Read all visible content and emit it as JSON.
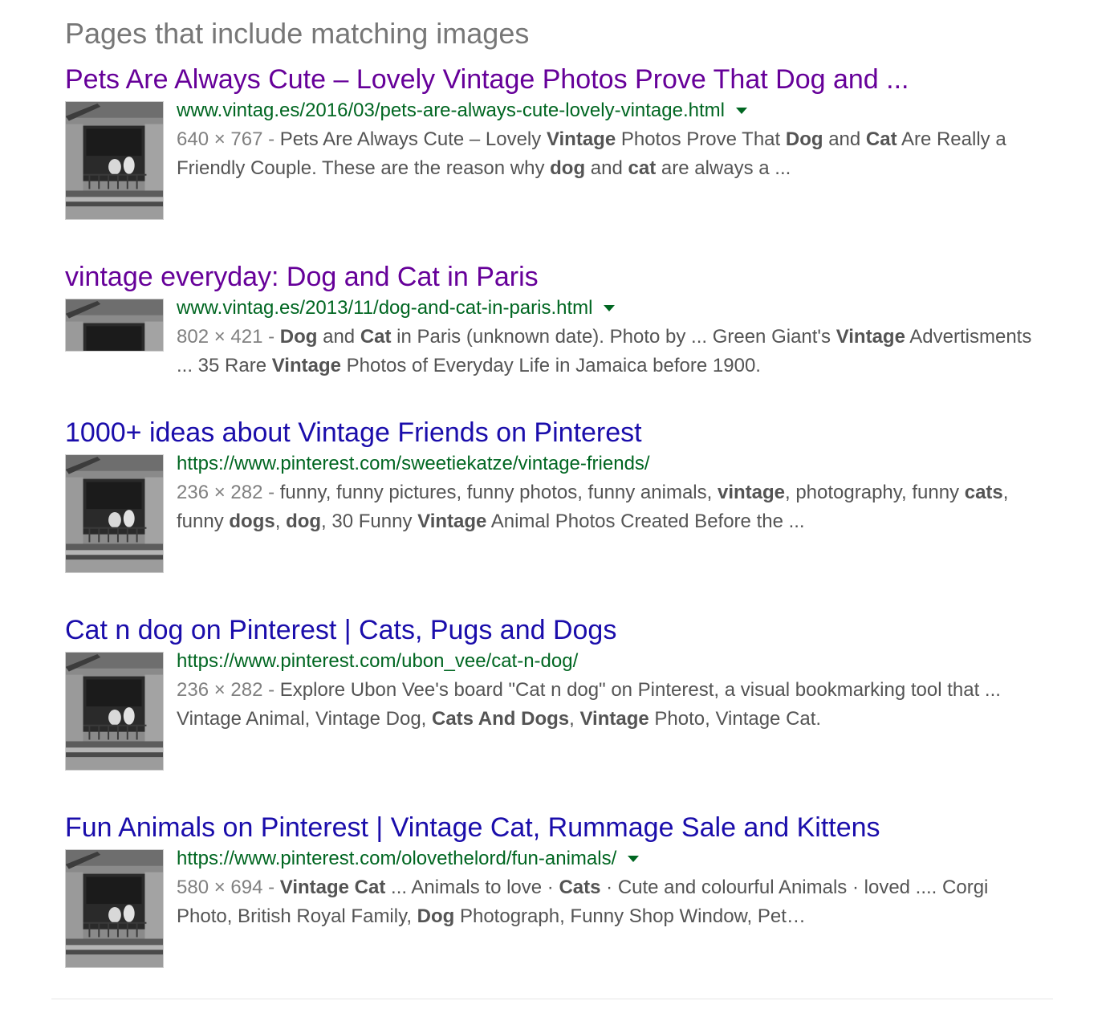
{
  "section_heading": "Pages that include matching images",
  "results": [
    {
      "title": "Pets Are Always Cute – Lovely Vintage Photos Prove That Dog and ...",
      "url": "www.vintag.es/2016/03/pets-are-always-cute-lovely-vintage.html",
      "has_caret": true,
      "visited": true,
      "thumbnail": "tall",
      "dims": "640 × 767",
      "snippet_segments": [
        {
          "text": "Pets Are Always Cute – Lovely ",
          "bold": false
        },
        {
          "text": "Vintage",
          "bold": true
        },
        {
          "text": " Photos Prove That ",
          "bold": false
        },
        {
          "text": "Dog",
          "bold": true
        },
        {
          "text": " and ",
          "bold": false
        },
        {
          "text": "Cat",
          "bold": true
        },
        {
          "text": " Are Really a Friendly Couple. These are the reason why ",
          "bold": false
        },
        {
          "text": "dog",
          "bold": true
        },
        {
          "text": " and ",
          "bold": false
        },
        {
          "text": "cat",
          "bold": true
        },
        {
          "text": " are always a ...",
          "bold": false
        }
      ]
    },
    {
      "title": "vintage everyday: Dog and Cat in Paris",
      "url": "www.vintag.es/2013/11/dog-and-cat-in-paris.html",
      "has_caret": true,
      "visited": true,
      "thumbnail": "short",
      "dims": "802 × 421",
      "snippet_segments": [
        {
          "text": "Dog",
          "bold": true
        },
        {
          "text": " and ",
          "bold": false
        },
        {
          "text": "Cat",
          "bold": true
        },
        {
          "text": " in Paris (unknown date). Photo by ... Green Giant's ",
          "bold": false
        },
        {
          "text": "Vintage",
          "bold": true
        },
        {
          "text": " Advertisments ... 35 Rare ",
          "bold": false
        },
        {
          "text": "Vintage",
          "bold": true
        },
        {
          "text": " Photos of Everyday Life in Jamaica before 1900.",
          "bold": false
        }
      ]
    },
    {
      "title": "1000+ ideas about Vintage Friends on Pinterest",
      "url": "https://www.pinterest.com/sweetiekatze/vintage-friends/",
      "has_caret": false,
      "visited": false,
      "thumbnail": "tall",
      "dims": "236 × 282",
      "snippet_segments": [
        {
          "text": "funny, funny pictures, funny photos, funny animals, ",
          "bold": false
        },
        {
          "text": "vintage",
          "bold": true
        },
        {
          "text": ", photography, funny ",
          "bold": false
        },
        {
          "text": "cats",
          "bold": true
        },
        {
          "text": ", funny ",
          "bold": false
        },
        {
          "text": "dogs",
          "bold": true
        },
        {
          "text": ", ",
          "bold": false
        },
        {
          "text": "dog",
          "bold": true
        },
        {
          "text": ", 30 Funny ",
          "bold": false
        },
        {
          "text": "Vintage",
          "bold": true
        },
        {
          "text": " Animal Photos Created Before the ...",
          "bold": false
        }
      ]
    },
    {
      "title": "Cat n dog on Pinterest | Cats, Pugs and Dogs",
      "url": "https://www.pinterest.com/ubon_vee/cat-n-dog/",
      "has_caret": false,
      "visited": false,
      "thumbnail": "tall",
      "dims": "236 × 282",
      "snippet_segments": [
        {
          "text": "Explore Ubon Vee's board \"Cat n dog\" on Pinterest, a visual bookmarking tool that ... Vintage Animal, Vintage Dog, ",
          "bold": false
        },
        {
          "text": "Cats And Dogs",
          "bold": true
        },
        {
          "text": ", ",
          "bold": false
        },
        {
          "text": "Vintage",
          "bold": true
        },
        {
          "text": " Photo, Vintage Cat.",
          "bold": false
        }
      ]
    },
    {
      "title": "Fun Animals on Pinterest | Vintage Cat, Rummage Sale and Kittens",
      "url": "https://www.pinterest.com/olovethelord/fun-animals/",
      "has_caret": true,
      "visited": false,
      "thumbnail": "tall",
      "dims": "580 × 694",
      "snippet_segments": [
        {
          "text": "Vintage Cat",
          "bold": true
        },
        {
          "text": " ... Animals to love · ",
          "bold": false
        },
        {
          "text": "Cats",
          "bold": true
        },
        {
          "text": " · Cute and colourful Animals · loved .... Corgi Photo, British Royal Family, ",
          "bold": false
        },
        {
          "text": "Dog",
          "bold": true
        },
        {
          "text": " Photograph, Funny Shop Window, Pet…",
          "bold": false
        }
      ]
    }
  ],
  "colors": {
    "visited_link": "#660099",
    "unvisited_link": "#1a0dab",
    "url_green": "#006621",
    "snippet_gray": "#545454",
    "heading_gray": "#777777"
  },
  "icons": {
    "caret": "caret-down-icon",
    "thumbnail": "photo-thumbnail"
  }
}
